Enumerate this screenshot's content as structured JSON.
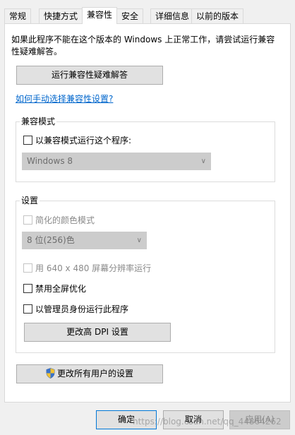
{
  "tabs": [
    {
      "label": "常规"
    },
    {
      "label": "快捷方式"
    },
    {
      "label": "兼容性"
    },
    {
      "label": "安全"
    },
    {
      "label": "详细信息"
    },
    {
      "label": "以前的版本"
    }
  ],
  "description": "如果此程序不能在这个版本的 Windows 上正常工作，请尝试运行兼容性疑难解答。",
  "troubleshoot_button": "运行兼容性疑难解答",
  "manual_link": "如何手动选择兼容性设置?",
  "compat_mode": {
    "title": "兼容模式",
    "checkbox_label": "以兼容模式运行这个程序:",
    "os_select": "Windows 8"
  },
  "settings": {
    "title": "设置",
    "reduced_color_label": "简化的颜色模式",
    "color_select": "8 位(256)色",
    "resolution_label": "用 640 x 480 屏幕分辨率运行",
    "fullscreen_label": "禁用全屏优化",
    "admin_label": "以管理员身份运行此程序",
    "dpi_button": "更改高 DPI 设置"
  },
  "all_users_button": "更改所有用户的设置",
  "footer": {
    "ok": "确定",
    "cancel": "取消",
    "apply": "应用(A)"
  },
  "watermark": "https://blog.csdn.net/qq_44864262"
}
